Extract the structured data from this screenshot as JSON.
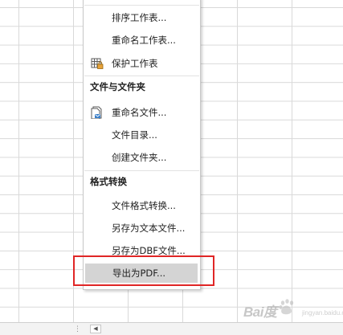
{
  "menu": {
    "items_top": [
      {
        "label": "排序工作表...",
        "icon": null
      },
      {
        "label": "重命名工作表...",
        "icon": null
      },
      {
        "label": "保护工作表",
        "icon": "protect-sheet-icon"
      }
    ],
    "section_files": {
      "header": "文件与文件夹",
      "items": [
        {
          "label": "重命名文件...",
          "icon": "rename-file-icon"
        },
        {
          "label": "文件目录...",
          "icon": null
        },
        {
          "label": "创建文件夹...",
          "icon": null
        }
      ]
    },
    "section_convert": {
      "header": "格式转换",
      "items": [
        {
          "label": "文件格式转换...",
          "icon": null
        },
        {
          "label": "另存为文本文件...",
          "icon": null
        },
        {
          "label": "另存为DBF文件...",
          "icon": null
        },
        {
          "label": "导出为PDF...",
          "icon": null,
          "highlighted": true
        }
      ]
    }
  },
  "statusbar": {
    "scroll_left_glyph": "◀",
    "grip_glyph": "⋮"
  },
  "colors": {
    "highlight_box": "#e02626",
    "hover_background": "#d4d4d4"
  },
  "watermark": {
    "brand": "Bai度",
    "sub": "jingyan.baidu.com"
  }
}
